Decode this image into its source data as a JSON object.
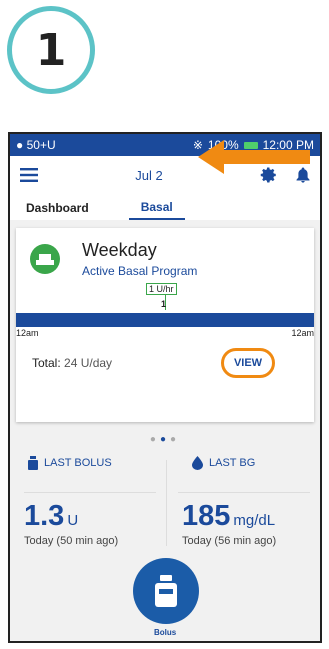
{
  "step_number": "1",
  "status_bar": {
    "left": "50+U",
    "battery": "100%",
    "time": "12:00 PM"
  },
  "app_bar": {
    "date": "Jul 2"
  },
  "tabs": [
    {
      "label": "Dashboard"
    },
    {
      "label": "Basal"
    }
  ],
  "basal_card": {
    "program_name": "Weekday",
    "program_status": "Active Basal Program",
    "rate_label": "1 U/hr",
    "bar_value": "1",
    "start_time": "12am",
    "end_time": "12am",
    "total_label": "Total:",
    "total_value": "24 U/day",
    "view_label": "VIEW"
  },
  "last_bolus": {
    "label": "LAST BOLUS",
    "value": "1.3",
    "unit": "U",
    "time": "Today (50 min ago)"
  },
  "last_bg": {
    "label": "LAST BG",
    "value": "185",
    "unit": "mg/dL",
    "time": "Today (56 min ago)"
  },
  "bolus_button": {
    "label": "Bolus"
  },
  "colors": {
    "primary": "#1b4a9b",
    "accent": "#f08a12",
    "program_green": "#3aa64a",
    "step_ring": "#5cc3c7"
  }
}
